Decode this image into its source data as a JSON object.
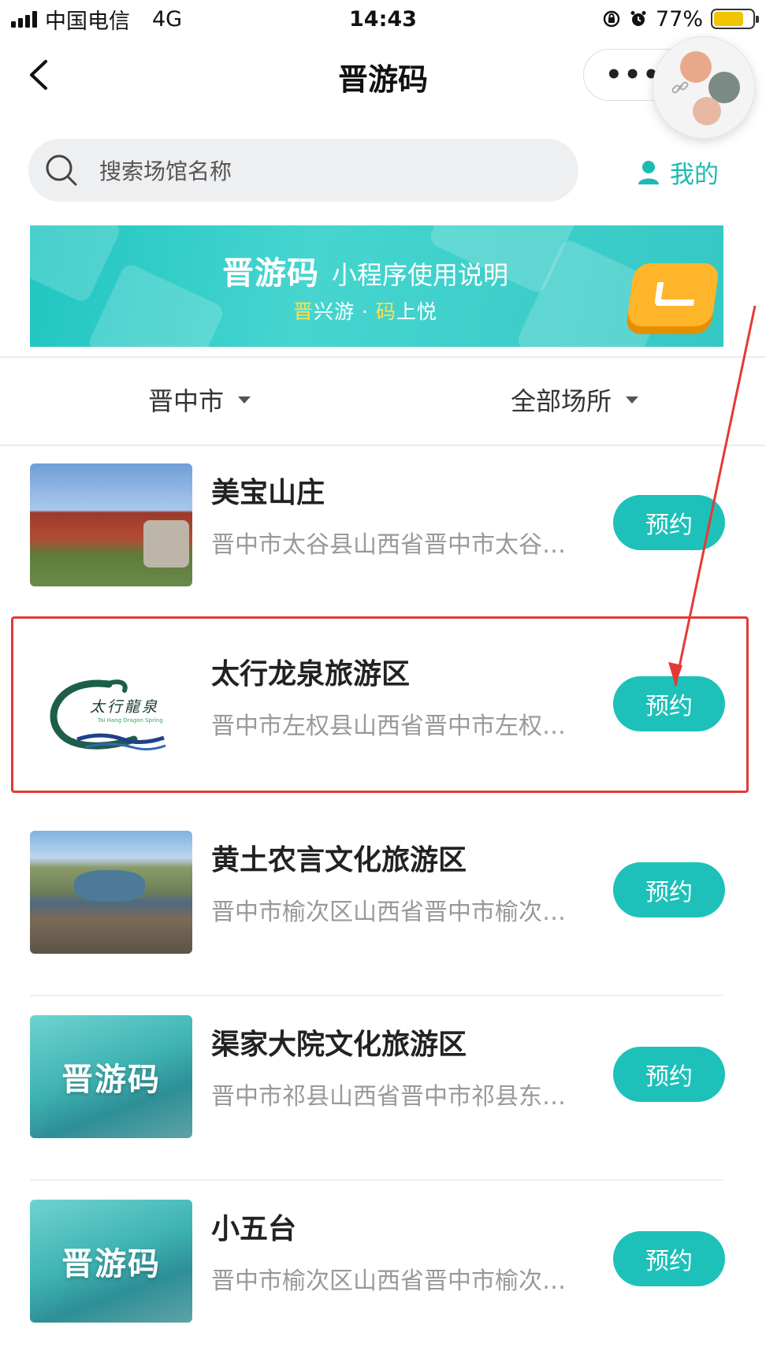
{
  "status_bar": {
    "carrier": "中国电信",
    "network": "4G",
    "time": "14:43",
    "battery": "77%"
  },
  "nav": {
    "title": "晋游码",
    "back_icon": "chevron-left-icon",
    "more_icon": "more-dots-icon"
  },
  "search": {
    "placeholder": "搜索场馆名称"
  },
  "mine_label": "我的",
  "banner": {
    "brand": "晋游码",
    "desc": "小程序使用说明",
    "sub_a": "晋",
    "sub_b": "兴游 · ",
    "sub_c": "码",
    "sub_d": "上悦"
  },
  "filters": {
    "city": "晋中市",
    "category": "全部场所"
  },
  "venues": [
    {
      "name": "美宝山庄",
      "address": "晋中市太谷县山西省晋中市太谷…",
      "button": "预约"
    },
    {
      "name": "太行龙泉旅游区",
      "address": "晋中市左权县山西省晋中市左权…",
      "button": "预约",
      "logo_text": "太行龍泉",
      "logo_sub": "Tai Hang Dragon Spring"
    },
    {
      "name": "黄土农言文化旅游区",
      "address": "晋中市榆次区山西省晋中市榆次…",
      "button": "预约"
    },
    {
      "name": "渠家大院文化旅游区",
      "address": "晋中市祁县山西省晋中市祁县东…",
      "button": "预约",
      "placeholder_logo": "晋游码"
    },
    {
      "name": "小五台",
      "address": "晋中市榆次区山西省晋中市榆次…",
      "button": "预约",
      "placeholder_logo": "晋游码"
    }
  ],
  "colors": {
    "accent": "#1dc1b9",
    "highlight": "#e53935",
    "battery": "#f2c400"
  }
}
